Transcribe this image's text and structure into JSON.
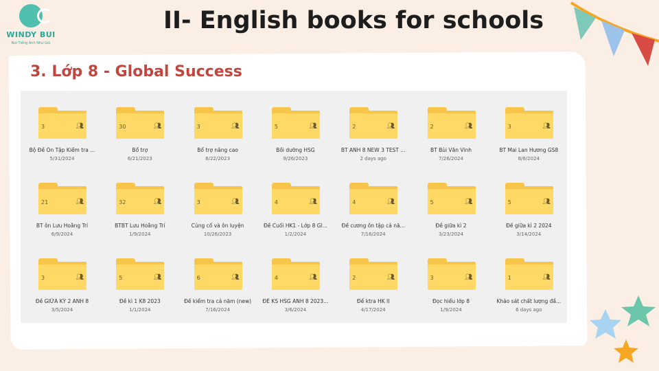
{
  "logo": {
    "name": "WINDY BUI",
    "tagline": "Nói Tiếng Anh Như Gió"
  },
  "title": "II- English books for schools",
  "section": "3. Lớp 8 - Global Success",
  "colors": {
    "accent": "#c0473f",
    "folder": "#ffd966",
    "folder_dark": "#f6c54a",
    "teal": "#4fbfb0"
  },
  "folders": [
    {
      "count": "3",
      "name": "Bộ Đề Ôn Tập Kiểm tra ...",
      "date": "5/31/2024"
    },
    {
      "count": "30",
      "name": "Bổ trợ",
      "date": "6/21/2023"
    },
    {
      "count": "3",
      "name": "Bổ trợ nâng cao",
      "date": "8/22/2023"
    },
    {
      "count": "5",
      "name": "Bồi dưỡng HSG",
      "date": "9/26/2023"
    },
    {
      "count": "2",
      "name": "BT ANH 8 NEW 3 TEST ...",
      "date": "2 days ago"
    },
    {
      "count": "2",
      "name": "BT Bùi Văn Vinh",
      "date": "7/26/2024"
    },
    {
      "count": "3",
      "name": "BT Mai Lan Hương GS8",
      "date": "8/8/2024"
    },
    {
      "count": "21",
      "name": "BT ôn Lưu Hoằng Trí",
      "date": "6/9/2024"
    },
    {
      "count": "32",
      "name": "BTBT Lưu Hoằng Trí",
      "date": "1/9/2024"
    },
    {
      "count": "3",
      "name": "Củng cố và ôn luyện",
      "date": "10/26/2023"
    },
    {
      "count": "4",
      "name": "Đề Cuối HK1 - Lớp 8 Gl...",
      "date": "1/2/2024"
    },
    {
      "count": "4",
      "name": "Đề cương ôn tập cả nă...",
      "date": "7/16/2024"
    },
    {
      "count": "5",
      "name": "Đề giữa kì 2",
      "date": "3/23/2024"
    },
    {
      "count": "5",
      "name": "Đề giữa kì 2 2024",
      "date": "3/14/2024"
    },
    {
      "count": "3",
      "name": "Đề GIỮA KỲ 2 ANH 8",
      "date": "3/5/2024"
    },
    {
      "count": "5",
      "name": "Đề kì 1 K8 2023",
      "date": "1/1/2024"
    },
    {
      "count": "6",
      "name": "Đề kiểm tra cả năm (new)",
      "date": "7/16/2024"
    },
    {
      "count": "4",
      "name": "ĐỀ KS HSG ANH 8 2023...",
      "date": "3/6/2024"
    },
    {
      "count": "2",
      "name": "Đề ktra HK II",
      "date": "4/17/2024"
    },
    {
      "count": "3",
      "name": "Đọc hiểu lớp 8",
      "date": "1/9/2024"
    },
    {
      "count": "1",
      "name": "Khảo sát chất lượng đầ...",
      "date": "6 days ago"
    }
  ]
}
